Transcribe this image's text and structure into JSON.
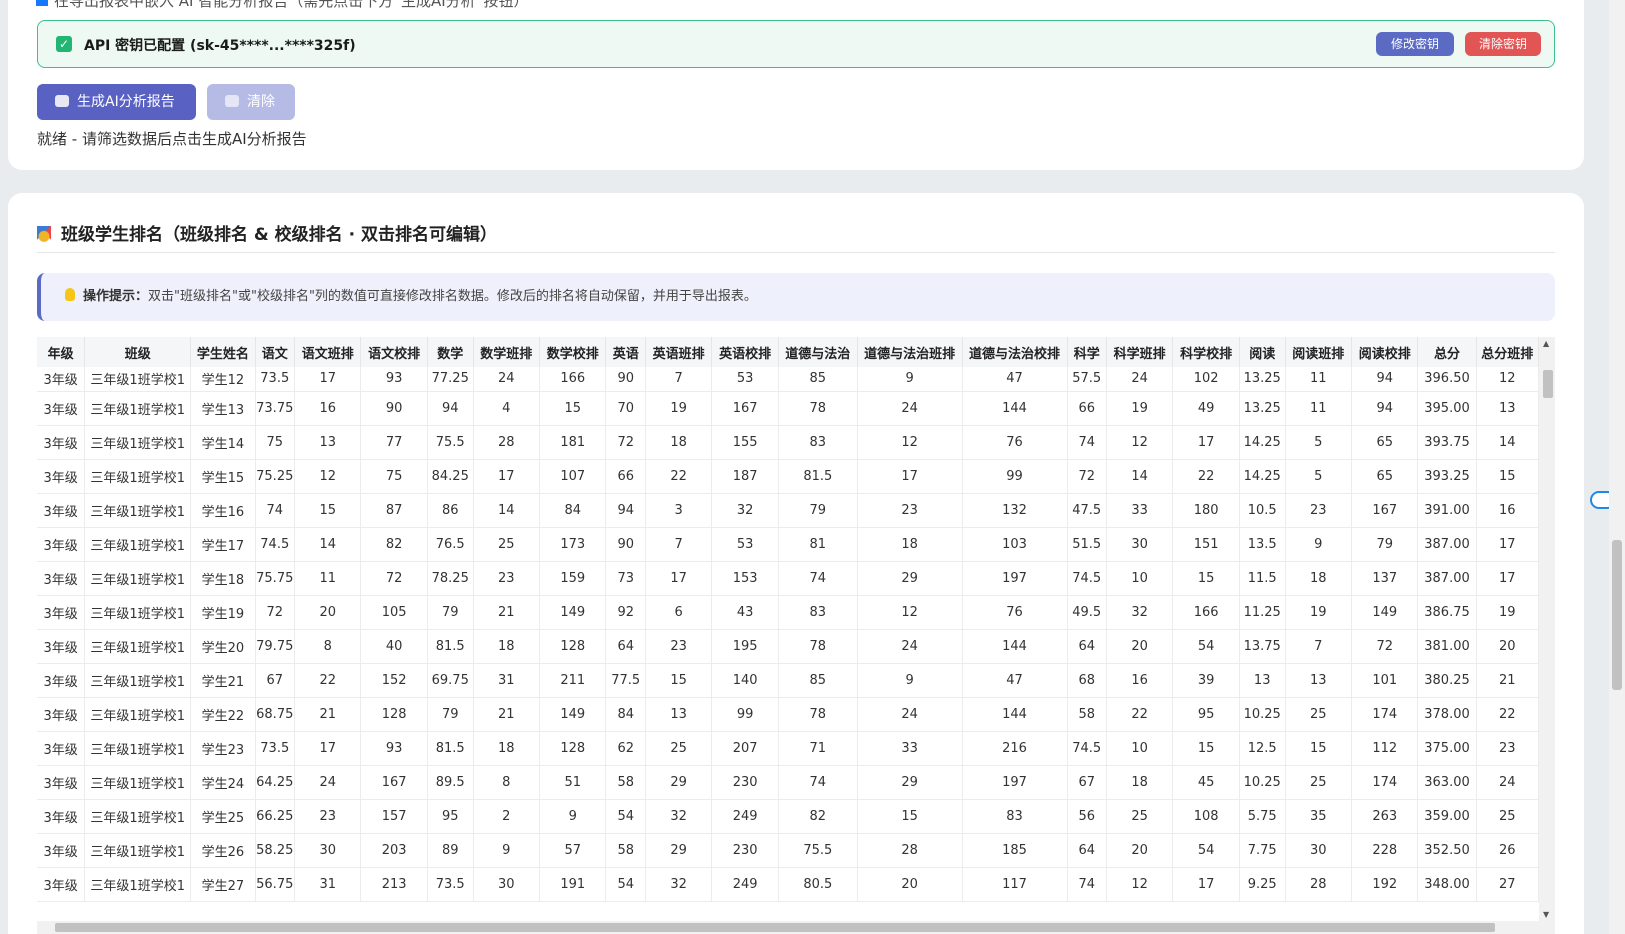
{
  "export_option": {
    "label": "在导出报表中嵌入 AI 智能分析报告（需先点击下方“生成AI分析”按钮）"
  },
  "api": {
    "status": "API 密钥已配置 (sk-45****...****325f)",
    "edit_label": "修改密钥",
    "clear_label": "清除密钥"
  },
  "actions": {
    "generate_label": "生成AI分析报告",
    "reset_label": "清除"
  },
  "status_text": "就绪 - 请筛选数据后点击生成AI分析报告",
  "ranking": {
    "title": "班级学生排名（班级排名 & 校级排名 · 双击排名可编辑）",
    "tip_label": "操作提示：",
    "tip_text": "双击\"班级排名\"或\"校级排名\"列的数值可直接修改排名数据。修改后的排名将自动保留，并用于导出报表。"
  },
  "table": {
    "columns": [
      "年级",
      "班级",
      "学生姓名",
      "语文",
      "语文班排",
      "语文校排",
      "数学",
      "数学班排",
      "数学校排",
      "英语",
      "英语班排",
      "英语校排",
      "道德与法治",
      "道德与法治班排",
      "道德与法治校排",
      "科学",
      "科学班排",
      "科学校排",
      "阅读",
      "阅读班排",
      "阅读校排",
      "总分",
      "总分班排"
    ],
    "rows": [
      [
        "3年级",
        "三年级1班学校1",
        "学生12",
        "73.5",
        "17",
        "93",
        "77.25",
        "24",
        "166",
        "90",
        "7",
        "53",
        "85",
        "9",
        "47",
        "57.5",
        "24",
        "102",
        "13.25",
        "11",
        "94",
        "396.50",
        "12"
      ],
      [
        "3年级",
        "三年级1班学校1",
        "学生13",
        "73.75",
        "16",
        "90",
        "94",
        "4",
        "15",
        "70",
        "19",
        "167",
        "78",
        "24",
        "144",
        "66",
        "19",
        "49",
        "13.25",
        "11",
        "94",
        "395.00",
        "13"
      ],
      [
        "3年级",
        "三年级1班学校1",
        "学生14",
        "75",
        "13",
        "77",
        "75.5",
        "28",
        "181",
        "72",
        "18",
        "155",
        "83",
        "12",
        "76",
        "74",
        "12",
        "17",
        "14.25",
        "5",
        "65",
        "393.75",
        "14"
      ],
      [
        "3年级",
        "三年级1班学校1",
        "学生15",
        "75.25",
        "12",
        "75",
        "84.25",
        "17",
        "107",
        "66",
        "22",
        "187",
        "81.5",
        "17",
        "99",
        "72",
        "14",
        "22",
        "14.25",
        "5",
        "65",
        "393.25",
        "15"
      ],
      [
        "3年级",
        "三年级1班学校1",
        "学生16",
        "74",
        "15",
        "87",
        "86",
        "14",
        "84",
        "94",
        "3",
        "32",
        "79",
        "23",
        "132",
        "47.5",
        "33",
        "180",
        "10.5",
        "23",
        "167",
        "391.00",
        "16"
      ],
      [
        "3年级",
        "三年级1班学校1",
        "学生17",
        "74.5",
        "14",
        "82",
        "76.5",
        "25",
        "173",
        "90",
        "7",
        "53",
        "81",
        "18",
        "103",
        "51.5",
        "30",
        "151",
        "13.5",
        "9",
        "79",
        "387.00",
        "17"
      ],
      [
        "3年级",
        "三年级1班学校1",
        "学生18",
        "75.75",
        "11",
        "72",
        "78.25",
        "23",
        "159",
        "73",
        "17",
        "153",
        "74",
        "29",
        "197",
        "74.5",
        "10",
        "15",
        "11.5",
        "18",
        "137",
        "387.00",
        "17"
      ],
      [
        "3年级",
        "三年级1班学校1",
        "学生19",
        "72",
        "20",
        "105",
        "79",
        "21",
        "149",
        "92",
        "6",
        "43",
        "83",
        "12",
        "76",
        "49.5",
        "32",
        "166",
        "11.25",
        "19",
        "149",
        "386.75",
        "19"
      ],
      [
        "3年级",
        "三年级1班学校1",
        "学生20",
        "79.75",
        "8",
        "40",
        "81.5",
        "18",
        "128",
        "64",
        "23",
        "195",
        "78",
        "24",
        "144",
        "64",
        "20",
        "54",
        "13.75",
        "7",
        "72",
        "381.00",
        "20"
      ],
      [
        "3年级",
        "三年级1班学校1",
        "学生21",
        "67",
        "22",
        "152",
        "69.75",
        "31",
        "211",
        "77.5",
        "15",
        "140",
        "85",
        "9",
        "47",
        "68",
        "16",
        "39",
        "13",
        "13",
        "101",
        "380.25",
        "21"
      ],
      [
        "3年级",
        "三年级1班学校1",
        "学生22",
        "68.75",
        "21",
        "128",
        "79",
        "21",
        "149",
        "84",
        "13",
        "99",
        "78",
        "24",
        "144",
        "58",
        "22",
        "95",
        "10.25",
        "25",
        "174",
        "378.00",
        "22"
      ],
      [
        "3年级",
        "三年级1班学校1",
        "学生23",
        "73.5",
        "17",
        "93",
        "81.5",
        "18",
        "128",
        "62",
        "25",
        "207",
        "71",
        "33",
        "216",
        "74.5",
        "10",
        "15",
        "12.5",
        "15",
        "112",
        "375.00",
        "23"
      ],
      [
        "3年级",
        "三年级1班学校1",
        "学生24",
        "64.25",
        "24",
        "167",
        "89.5",
        "8",
        "51",
        "58",
        "29",
        "230",
        "74",
        "29",
        "197",
        "67",
        "18",
        "45",
        "10.25",
        "25",
        "174",
        "363.00",
        "24"
      ],
      [
        "3年级",
        "三年级1班学校1",
        "学生25",
        "66.25",
        "23",
        "157",
        "95",
        "2",
        "9",
        "54",
        "32",
        "249",
        "82",
        "15",
        "83",
        "56",
        "25",
        "108",
        "5.75",
        "35",
        "263",
        "359.00",
        "25"
      ],
      [
        "3年级",
        "三年级1班学校1",
        "学生26",
        "58.25",
        "30",
        "203",
        "89",
        "9",
        "57",
        "58",
        "29",
        "230",
        "75.5",
        "28",
        "185",
        "64",
        "20",
        "54",
        "7.75",
        "30",
        "228",
        "352.50",
        "26"
      ],
      [
        "3年级",
        "三年级1班学校1",
        "学生27",
        "56.75",
        "31",
        "213",
        "73.5",
        "30",
        "191",
        "54",
        "32",
        "249",
        "80.5",
        "20",
        "117",
        "74",
        "12",
        "17",
        "9.25",
        "28",
        "192",
        "348.00",
        "27"
      ]
    ]
  },
  "icons": {
    "checkbox": "check-icon",
    "robot": "robot-icon",
    "trash": "trash-icon",
    "medal": "medal-icon",
    "bulb": "lightbulb-icon",
    "cloud": "cloud-icon"
  },
  "colors": {
    "primary": "#5961c2",
    "success": "#22b573",
    "danger": "#e25555"
  }
}
